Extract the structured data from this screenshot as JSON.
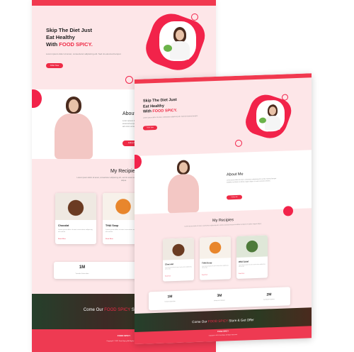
{
  "colors": {
    "accent": "#ee2b46",
    "background": "#fde6e8",
    "white": "#ffffff"
  },
  "hero": {
    "title_line1": "Skip The Diet Just",
    "title_line2": "Eat Healthy",
    "title_with": "With",
    "title_accent": "FOOD SPICY.",
    "text": "Lorem ipsum dolor sit amet, consectetur adipiscing elit. Sed do eiusmod tempor.",
    "button": "Order Now"
  },
  "about": {
    "title": "About Me",
    "text": "Lorem ipsum dolor sit amet, consectetur adipiscing elit, sed do eiusmod tempor incididunt ut labore et dolore magna aliqua. Ut enim ad minim veniam.",
    "button": "Follow Me"
  },
  "recipes": {
    "title": "My Recipies",
    "subtitle": "Lorem ipsum dolor sit amet, consectetur adipiscing elit, sed do eiusmod tempor incididunt ut labore et dolore magna aliqua.",
    "cards": [
      {
        "name": "Chocolat",
        "text": "Lorem ipsum dolor sit amet consectetur adipiscing elit sed do.",
        "link": "Read More"
      },
      {
        "name": "THAI Soup",
        "text": "Lorem ipsum dolor sit amet consectetur adipiscing elit sed do.",
        "link": "Read More"
      },
      {
        "name": "Wild Salad",
        "text": "Lorem ipsum dolor sit amet consectetur adipiscing elit sed do.",
        "link": "Read More"
      }
    ]
  },
  "stats": [
    {
      "value": "1M",
      "label": "Youtube Subscriber"
    },
    {
      "value": "3M",
      "label": "Instagram Followers"
    },
    {
      "value": "2M",
      "label": "Facebook Followers"
    }
  ],
  "store": {
    "prefix": "Come Our",
    "accent": "FOOD SPICY",
    "suffix": "Store & Get Offer"
  },
  "footer": {
    "brand": "FOOD SPICY",
    "copy": "Copyright © 2021 Food Spicy. All Rights Reserved."
  }
}
